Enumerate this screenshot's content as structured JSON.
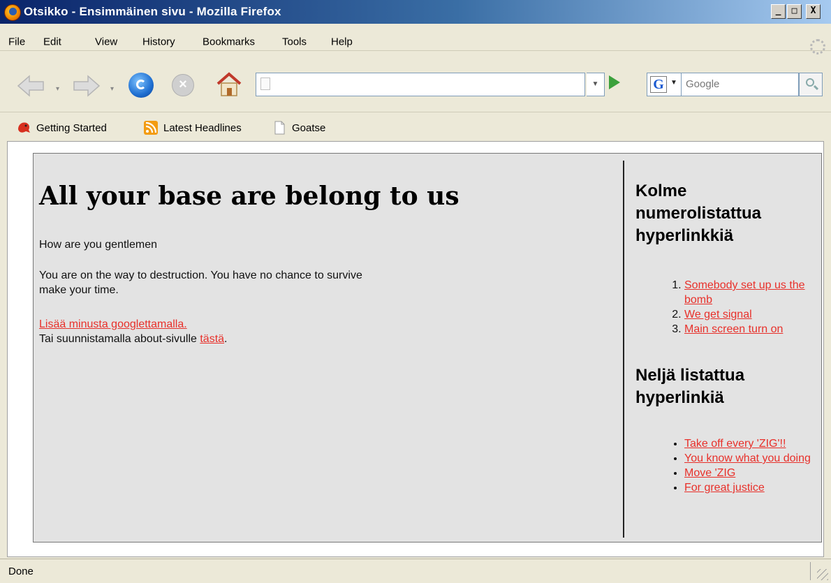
{
  "window": {
    "title": "Otsikko - Ensimmäinen sivu - Mozilla Firefox",
    "buttons": {
      "minimize": "_",
      "maximize": "□",
      "close": "X"
    }
  },
  "menu": [
    "File",
    "Edit",
    "View",
    "History",
    "Bookmarks",
    "Tools",
    "Help"
  ],
  "navbar": {
    "url_value": "",
    "search_placeholder": "Google",
    "search_engine_letter": "G"
  },
  "bookmarks": [
    {
      "label": "Getting Started",
      "icon": "firefox-bookmark-icon"
    },
    {
      "label": "Latest Headlines",
      "icon": "rss-icon"
    },
    {
      "label": "Goatse",
      "icon": "page-icon"
    }
  ],
  "content": {
    "heading": "All your base are belong to us",
    "para1": "How are you gentlemen",
    "para2_line1": "You are on the way to destruction. You have no chance to survive",
    "para2_line2": "make your time.",
    "link_google": "Lisää minusta googlettamalla.",
    "about_prefix": "Tai suunnistamalla about-sivulle ",
    "about_link": "tästä",
    "about_suffix": ".",
    "sidebar": {
      "heading1_lines": [
        "Kolme",
        "numerolistattua",
        "hyperlinkkiä"
      ],
      "numbered_links": [
        "Somebody set up us the bomb",
        "We get signal",
        "Main screen turn on"
      ],
      "heading2_lines": [
        "Neljä listattua",
        "hyperlinkiä"
      ],
      "bullet_links": [
        "Take off every 'ZIG'!!",
        "You know what you doing",
        "Move 'ZIG",
        "For great justice"
      ]
    }
  },
  "status": {
    "text": "Done"
  },
  "colors": {
    "link": "#e8302a",
    "box_bg": "#e3e3e3",
    "chrome_bg": "#ece9d8",
    "titlebar": "#0a246a"
  }
}
